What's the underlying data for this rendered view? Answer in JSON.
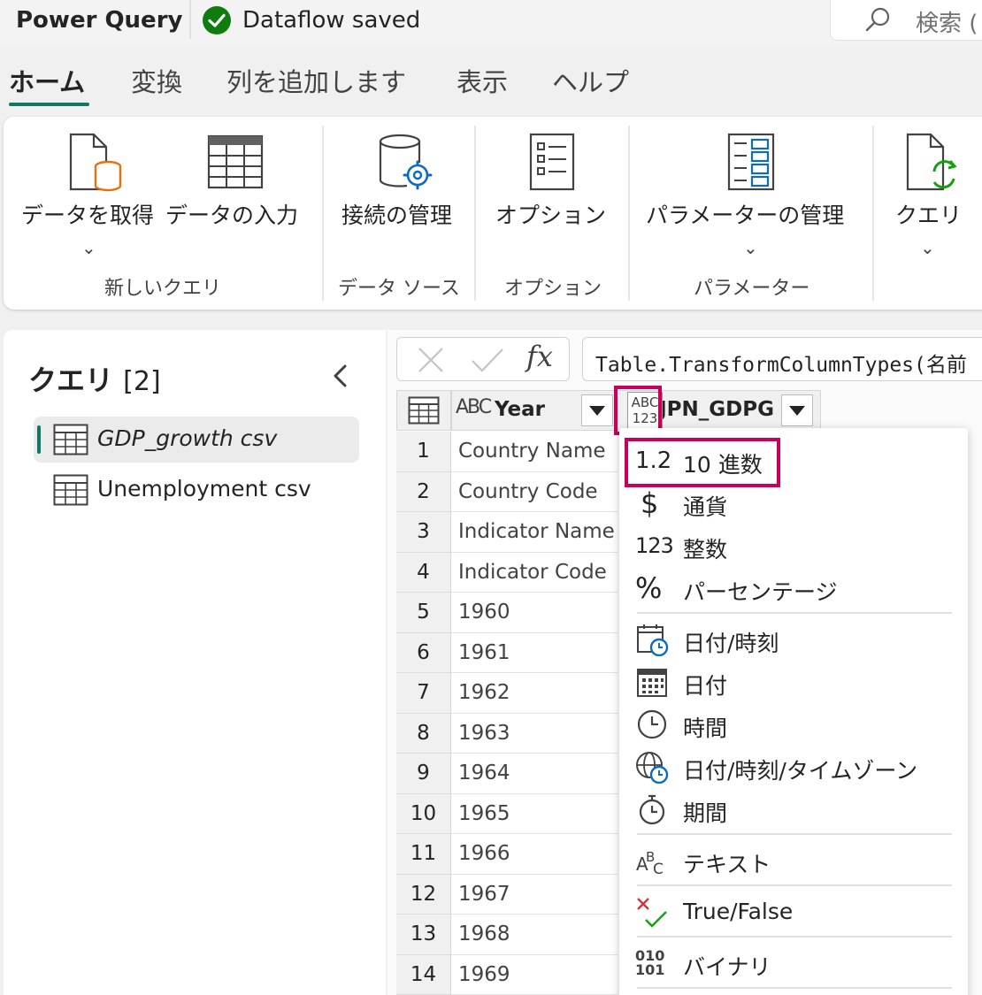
{
  "titlebar": {
    "app_title": "Power Query",
    "status_text": "Dataflow saved",
    "search_placeholder": "検索 ("
  },
  "tabs": [
    {
      "label": "ホーム",
      "active": true
    },
    {
      "label": "変換"
    },
    {
      "label": "列を追加します"
    },
    {
      "label": "表示"
    },
    {
      "label": "ヘルプ"
    }
  ],
  "ribbon": {
    "buttons": [
      {
        "label": "データを取得",
        "icon": "get-data-icon"
      },
      {
        "label": "データの入力",
        "icon": "enter-data-icon"
      },
      {
        "label": "接続の管理",
        "icon": "manage-connections-icon"
      },
      {
        "label": "オプション",
        "icon": "options-icon"
      },
      {
        "label": "パラメーターの管理",
        "icon": "manage-parameters-icon"
      },
      {
        "label": "クエリ",
        "icon": "query-refresh-icon"
      }
    ],
    "groups": [
      "新しいクエリ",
      "データ ソース",
      "オプション",
      "パラメーター"
    ]
  },
  "queries_panel": {
    "title": "クエリ",
    "count": "[2]",
    "items": [
      {
        "label": "GDP_growth csv",
        "selected": true
      },
      {
        "label": "Unemployment csv"
      }
    ]
  },
  "formula_bar": {
    "fx": "fx",
    "text": "Table.TransformColumnTypes(名前"
  },
  "grid": {
    "columns": [
      {
        "type_icon": "ABC",
        "name": "Year"
      },
      {
        "type_icon": "ABC 123",
        "name": "JPN_GDPG"
      }
    ],
    "rows": [
      {
        "num": "1",
        "value": "Country Name"
      },
      {
        "num": "2",
        "value": "Country Code"
      },
      {
        "num": "3",
        "value": "Indicator Name"
      },
      {
        "num": "4",
        "value": "Indicator Code"
      },
      {
        "num": "5",
        "value": "1960"
      },
      {
        "num": "6",
        "value": "1961"
      },
      {
        "num": "7",
        "value": "1962"
      },
      {
        "num": "8",
        "value": "1963"
      },
      {
        "num": "9",
        "value": "1964"
      },
      {
        "num": "10",
        "value": "1965"
      },
      {
        "num": "11",
        "value": "1966"
      },
      {
        "num": "12",
        "value": "1967"
      },
      {
        "num": "13",
        "value": "1968"
      },
      {
        "num": "14",
        "value": "1969"
      }
    ]
  },
  "type_menu": {
    "items": [
      {
        "icon_text": "1.2",
        "label": "10 進数"
      },
      {
        "icon_text": "$",
        "label": "通貨"
      },
      {
        "icon_text": "123",
        "label": "整数"
      },
      {
        "icon_text": "%",
        "label": "パーセンテージ"
      },
      {
        "label": "日付/時刻"
      },
      {
        "label": "日付"
      },
      {
        "label": "時間"
      },
      {
        "label": "日付/時刻/タイムゾーン"
      },
      {
        "label": "期間"
      },
      {
        "label": "テキスト"
      },
      {
        "label": "True/False"
      },
      {
        "icon_text": "010 101",
        "label": "バイナリ"
      }
    ]
  },
  "colors": {
    "accent_green": "#117865",
    "highlight_box": "#c8005a",
    "saved_check": "#107c10",
    "orange": "#e8700a",
    "blue": "#0f6cbd"
  }
}
